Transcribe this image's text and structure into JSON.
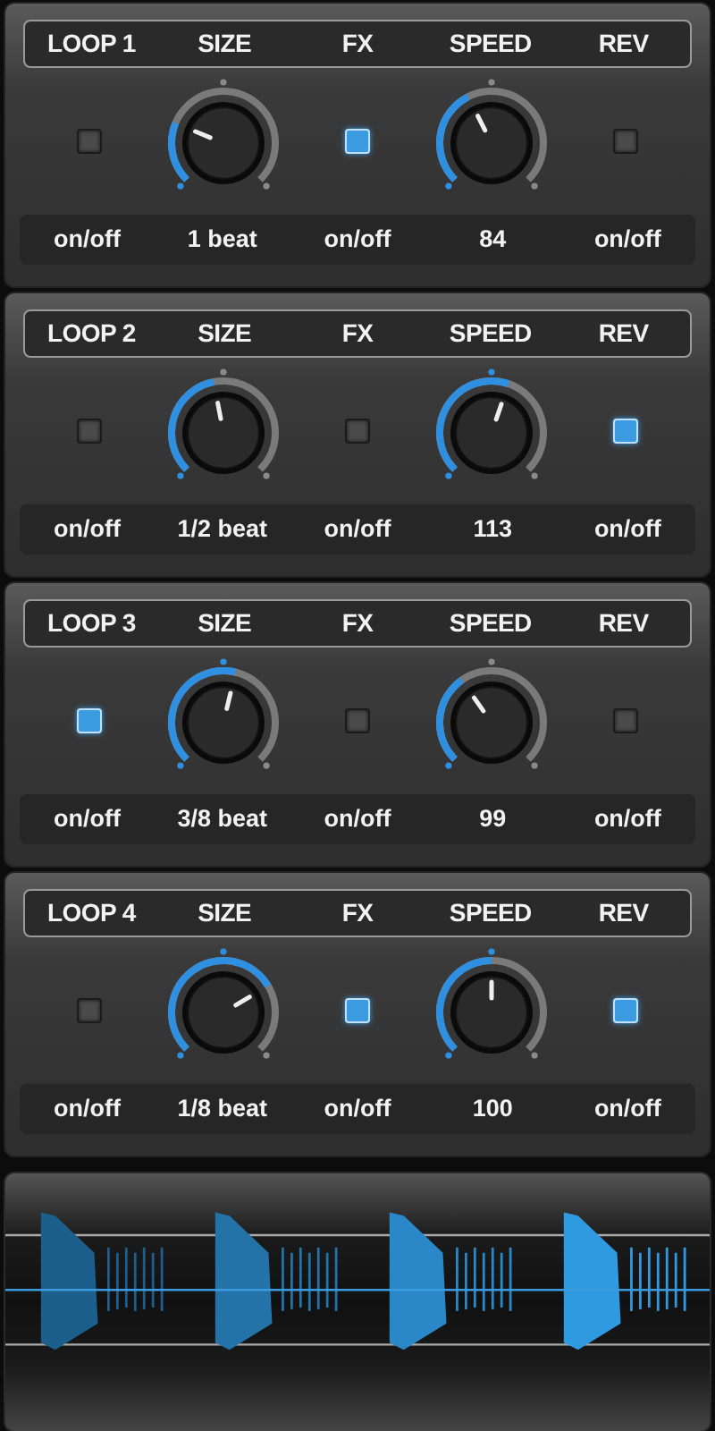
{
  "loops": [
    {
      "headers": [
        "LOOP 1",
        "SIZE",
        "FX",
        "SPEED",
        "REV"
      ],
      "controls": [
        {
          "kind": "toggle",
          "checked": false
        },
        {
          "kind": "knob"
        },
        {
          "kind": "toggle",
          "checked": true
        },
        {
          "kind": "knob"
        },
        {
          "kind": "toggle",
          "checked": false
        }
      ],
      "footers": [
        "on/off",
        "1 beat",
        "on/off",
        "84",
        "on/off"
      ]
    },
    {
      "headers": [
        "LOOP 2",
        "SIZE",
        "FX",
        "SPEED",
        "REV"
      ],
      "controls": [
        {
          "kind": "toggle",
          "checked": false
        },
        {
          "kind": "knob"
        },
        {
          "kind": "toggle",
          "checked": false
        },
        {
          "kind": "knob"
        },
        {
          "kind": "toggle",
          "checked": true
        }
      ],
      "footers": [
        "on/off",
        "1/2 beat",
        "on/off",
        "113",
        "on/off"
      ]
    },
    {
      "headers": [
        "LOOP 3",
        "SIZE",
        "FX",
        "SPEED",
        "REV"
      ],
      "controls": [
        {
          "kind": "toggle",
          "checked": true
        },
        {
          "kind": "knob"
        },
        {
          "kind": "toggle",
          "checked": false
        },
        {
          "kind": "knob"
        },
        {
          "kind": "toggle",
          "checked": false
        }
      ],
      "footers": [
        "on/off",
        "3/8 beat",
        "on/off",
        "99",
        "on/off"
      ]
    },
    {
      "headers": [
        "LOOP 4",
        "SIZE",
        "FX",
        "SPEED",
        "REV"
      ],
      "controls": [
        {
          "kind": "toggle",
          "checked": false
        },
        {
          "kind": "knob"
        },
        {
          "kind": "toggle",
          "checked": true
        },
        {
          "kind": "knob"
        },
        {
          "kind": "toggle",
          "checked": true
        }
      ],
      "footers": [
        "on/off",
        "1/8 beat",
        "on/off",
        "100",
        "on/off"
      ]
    }
  ]
}
